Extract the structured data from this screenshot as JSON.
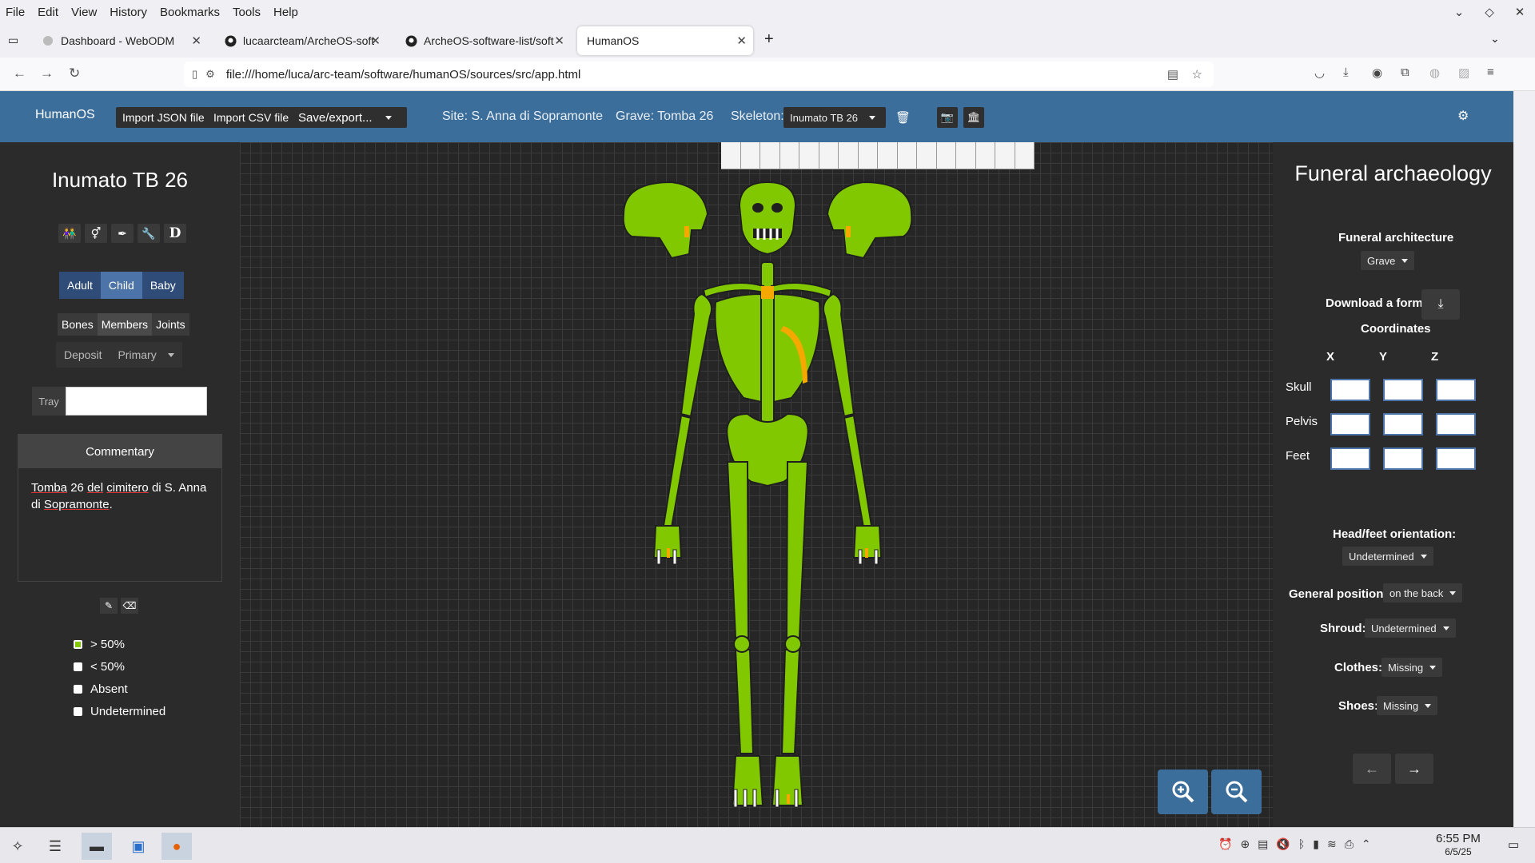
{
  "browser": {
    "menu": [
      "File",
      "Edit",
      "View",
      "History",
      "Bookmarks",
      "Tools",
      "Help"
    ],
    "window_controls": {
      "minimize": "⌄",
      "restore": "◇",
      "close": "✕"
    },
    "tabs": [
      {
        "label": "Dashboard - WebODM",
        "icon": "webodm-icon"
      },
      {
        "label": "lucaarcteam/ArcheOS-soft",
        "icon": "github-icon"
      },
      {
        "label": "ArcheOS-software-list/soft",
        "icon": "github-icon"
      },
      {
        "label": "HumanOS",
        "icon": "none"
      }
    ],
    "new_tab": "+",
    "url": "file:///home/luca/arc-team/software/humanOS/sources/src/app.html"
  },
  "header": {
    "brand": "HumanOS",
    "import_json": "Import JSON file",
    "import_csv": "Import CSV file",
    "save_export": "Save/export...",
    "site": "Site: S. Anna di Sopramonte",
    "grave": "Grave: Tomba 26",
    "skeleton_label": "Skeleton:",
    "skeleton_value": "Inumato TB 26"
  },
  "left": {
    "title": "Inumato TB 26",
    "tool_icons": [
      "people-icon",
      "gender-icon",
      "pen-icon",
      "wrench-icon",
      "d-icon"
    ],
    "tool_glyphs": [
      "👫",
      "⚥",
      "✒",
      "🔧",
      "D"
    ],
    "age_tabs": [
      "Adult",
      "Child",
      "Baby"
    ],
    "age_selected": "Child",
    "view_tabs": [
      "Bones",
      "Members",
      "Joints"
    ],
    "view_selected": "Members",
    "deposit_label": "Deposit",
    "deposit_value": "Primary",
    "tray_label": "Tray",
    "tray_value": "",
    "commentary_title": "Commentary",
    "commentary_text_1": "Tomba",
    "commentary_text_2": " 26 ",
    "commentary_text_3": "del",
    "commentary_text_4": " ",
    "commentary_text_5": "cimitero",
    "commentary_text_6": " di S. Anna di ",
    "commentary_text_7": "Sopramonte",
    "commentary_text_8": ".",
    "legend": [
      {
        "label": "> 50%",
        "color": "#82c800"
      },
      {
        "label": "< 50%",
        "color": "#ffffff"
      },
      {
        "label": "Absent",
        "color": "#ffffff"
      },
      {
        "label": "Undetermined",
        "color": "#ffffff"
      }
    ]
  },
  "canvas": {
    "bone_color": "#82c800",
    "partial_color": "#f5a800"
  },
  "right": {
    "title": "Funeral archaeology",
    "architecture_label": "Funeral architecture",
    "architecture_value": "Grave",
    "download_label": "Download a form",
    "coordinates_label": "Coordinates",
    "axes": [
      "X",
      "Y",
      "Z"
    ],
    "rows": [
      "Skull",
      "Pelvis",
      "Feet"
    ],
    "orientation_label": "Head/feet orientation:",
    "orientation_value": "Undetermined",
    "position_label": "General position:",
    "position_value": "on the back",
    "shroud_label": "Shroud:",
    "shroud_value": "Undetermined",
    "clothes_label": "Clothes:",
    "clothes_value": "Missing",
    "shoes_label": "Shoes:",
    "shoes_value": "Missing"
  },
  "taskbar": {
    "time": "6:55 PM",
    "date": "6/5/25"
  }
}
